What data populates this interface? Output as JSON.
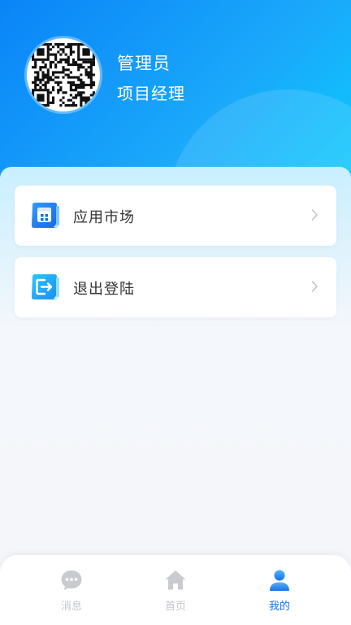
{
  "profile": {
    "name": "管理员",
    "role": "项目经理"
  },
  "menu": [
    {
      "label": "应用市场",
      "icon": "app-store-icon"
    },
    {
      "label": "退出登陆",
      "icon": "logout-icon"
    }
  ],
  "tabbar": [
    {
      "label": "消息",
      "icon": "chat-bubble-icon",
      "active": false
    },
    {
      "label": "首页",
      "icon": "home-icon",
      "active": false
    },
    {
      "label": "我的",
      "icon": "user-icon",
      "active": true
    }
  ],
  "colors": {
    "header_start": "#0a84f7",
    "header_end": "#09d3fd",
    "accent": "#1a6fe8",
    "tab_inactive": "#c4c6cc",
    "page_bg": "#f5f6fa"
  }
}
